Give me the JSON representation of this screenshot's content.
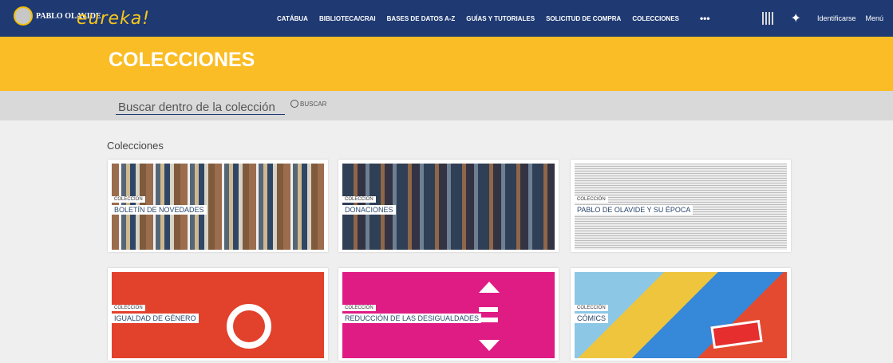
{
  "header": {
    "logo_text": "PABLO OLAVIDE",
    "brand": "eureka!",
    "nav": [
      "CATÁBUA",
      "BIBLIOTECA/CRAI",
      "BASES DE DATOS A-Z",
      "GUÍAS Y TUTORIALES",
      "SOLICITUD DE COMPRA",
      "COLECCIONES"
    ],
    "more": "•••",
    "login": "Identificarse",
    "menu": "Menú"
  },
  "banner": {
    "title": "COLECCIONES"
  },
  "search": {
    "placeholder": "Buscar dentro de la colección",
    "button": "BUSCAR"
  },
  "section": {
    "title": "Colecciones"
  },
  "cards": [
    {
      "tag": "COLECCIÓN",
      "name": "BOLETÍN DE NOVEDADES"
    },
    {
      "tag": "COLECCIÓN",
      "name": "DONACIONES"
    },
    {
      "tag": "COLECCIÓN",
      "name": "PABLO DE OLAVIDE Y SU ÉPOCA"
    },
    {
      "tag": "COLECCIÓN",
      "name": "IGUALDAD DE GÉNERO"
    },
    {
      "tag": "COLECCIÓN",
      "name": "REDUCCIÓN DE LAS DESIGUALDADES"
    },
    {
      "tag": "COLECCIÓN",
      "name": "CÓMICS"
    }
  ],
  "icons": [
    "logo-upo-icon",
    "qr-icon",
    "pin-icon",
    "search-icon"
  ]
}
